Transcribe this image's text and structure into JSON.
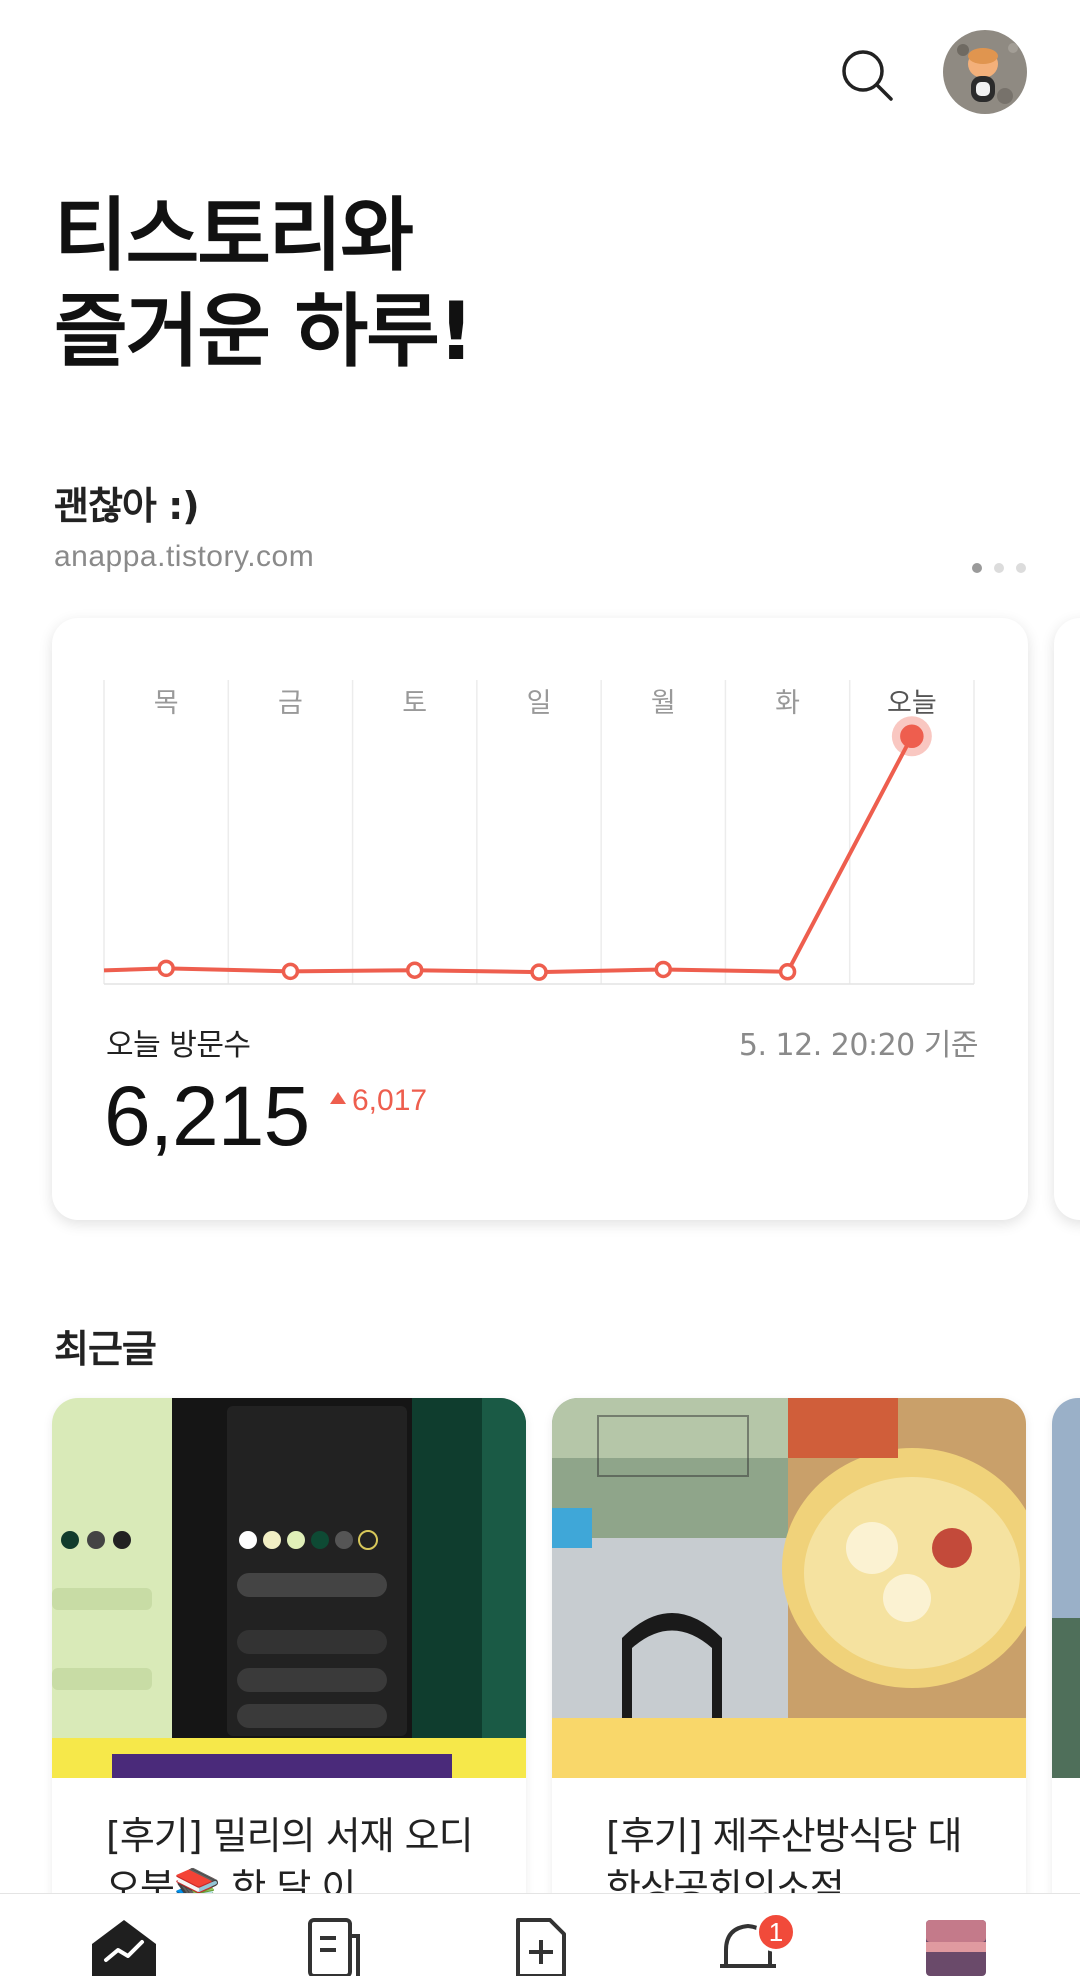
{
  "header": {
    "search_icon": "search-icon",
    "avatar": "profile-avatar"
  },
  "greeting": {
    "line1": "티스토리와",
    "line2": "즐거운 하루!"
  },
  "blog": {
    "name": "괜찮아 :)",
    "url": "anappa.tistory.com",
    "pager": {
      "count": 3,
      "active": 1
    }
  },
  "stats": {
    "visit_label": "오늘 방문수",
    "updated_at": "5. 12. 20:20 기준",
    "today_visits": "6,215",
    "delta": "6,017",
    "accent_color": "#ee5e4e"
  },
  "chart_data": {
    "type": "line",
    "categories": [
      "목",
      "금",
      "토",
      "일",
      "월",
      "화",
      "오늘"
    ],
    "values": [
      198,
      120,
      150,
      100,
      170,
      110,
      6215
    ],
    "ylim": [
      0,
      7000
    ],
    "grid": true,
    "highlight_last": true
  },
  "recent": {
    "title": "최근글",
    "posts": [
      {
        "title": "[후기] 밀리의 서재 오디오북📚 한 달 이…"
      },
      {
        "title": "[후기] 제주산방식당 대한상공회의소점 …"
      }
    ]
  },
  "nav": {
    "items": [
      {
        "icon": "home-stats-icon"
      },
      {
        "icon": "document-list-icon"
      },
      {
        "icon": "new-post-icon"
      },
      {
        "icon": "notification-bell-icon",
        "badge": "1"
      },
      {
        "icon": "blog-thumbnail"
      }
    ]
  }
}
